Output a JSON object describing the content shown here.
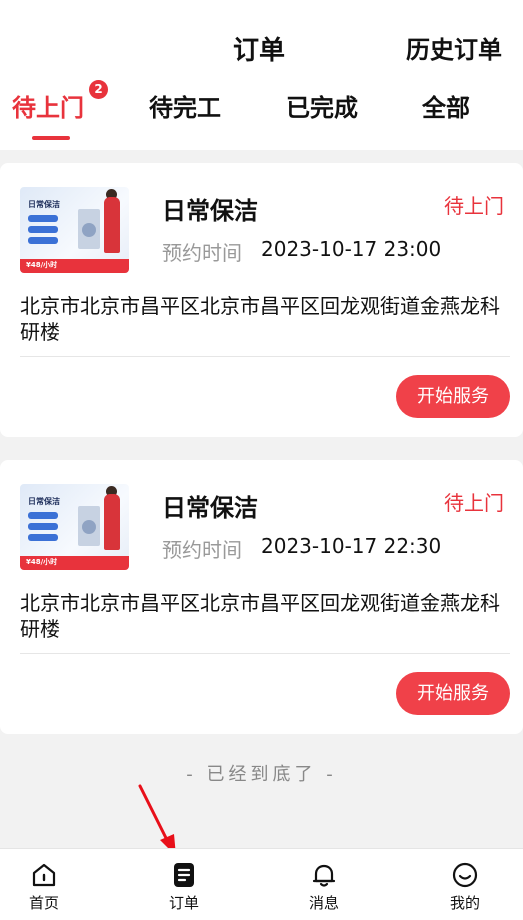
{
  "header": {
    "title": "订单",
    "history_link": "历史订单"
  },
  "tabs": [
    {
      "label": "待上门",
      "active": true,
      "badge": "2"
    },
    {
      "label": "待完工",
      "active": false
    },
    {
      "label": "已完成",
      "active": false
    },
    {
      "label": "全部",
      "active": false
    }
  ],
  "orders": [
    {
      "thumb": {
        "title": "日常保洁",
        "price": "¥48/小时"
      },
      "service": "日常保洁",
      "status": "待上门",
      "time_label": "预约时间",
      "time": "2023-10-17 23:00",
      "address": "北京市北京市昌平区北京市昌平区回龙观街道金燕龙科研楼",
      "action": "开始服务"
    },
    {
      "thumb": {
        "title": "日常保洁",
        "price": "¥48/小时"
      },
      "service": "日常保洁",
      "status": "待上门",
      "time_label": "预约时间",
      "time": "2023-10-17 22:30",
      "address": "北京市北京市昌平区北京市昌平区回龙观街道金燕龙科研楼",
      "action": "开始服务"
    }
  ],
  "end_note": "- 已经到底了 -",
  "tabbar": [
    {
      "label": "首页",
      "icon": "home-icon"
    },
    {
      "label": "订单",
      "icon": "order-icon"
    },
    {
      "label": "消息",
      "icon": "bell-icon"
    },
    {
      "label": "我的",
      "icon": "smile-icon"
    }
  ],
  "colors": {
    "accent": "#e8333c",
    "button": "#f04149",
    "background": "#f2f2f2"
  }
}
